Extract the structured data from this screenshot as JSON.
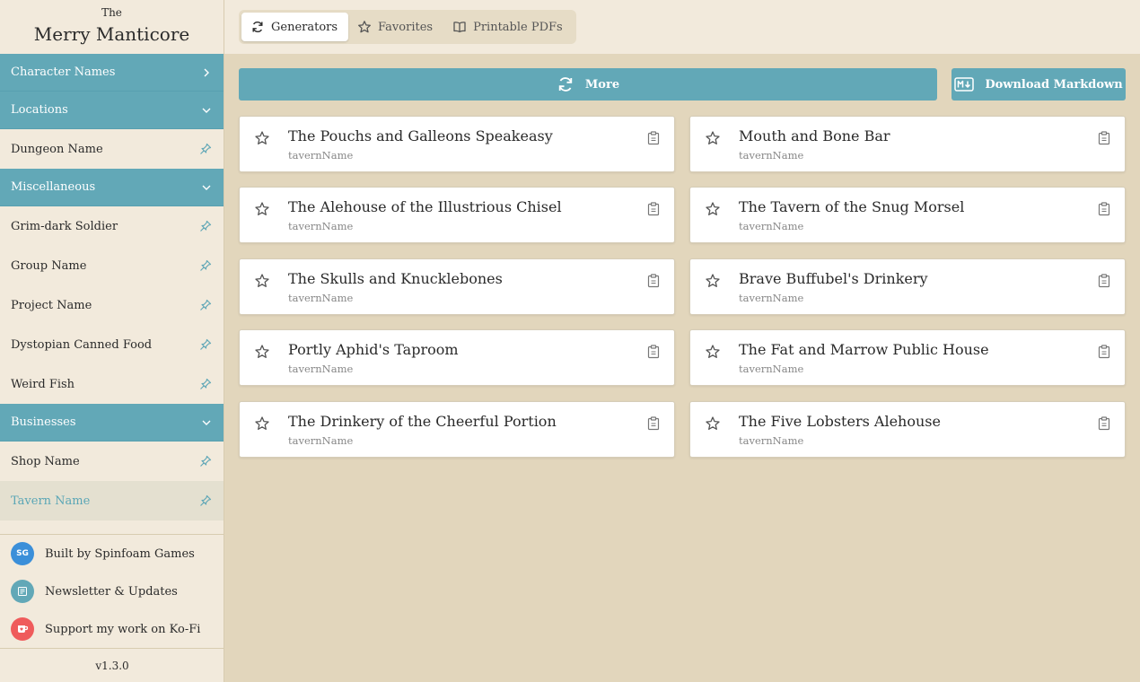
{
  "brand": {
    "the": "The",
    "name": "Merry Manticore"
  },
  "sidebar": {
    "sections": [
      {
        "label": "Character Names",
        "items": []
      },
      {
        "label": "Locations",
        "items": [
          {
            "label": "Dungeon Name"
          }
        ]
      },
      {
        "label": "Miscellaneous",
        "items": [
          {
            "label": "Grim-dark Soldier"
          },
          {
            "label": "Group Name"
          },
          {
            "label": "Project Name"
          },
          {
            "label": "Dystopian Canned Food"
          },
          {
            "label": "Weird Fish"
          }
        ]
      },
      {
        "label": "Businesses",
        "items": [
          {
            "label": "Shop Name"
          },
          {
            "label": "Tavern Name",
            "active": true
          }
        ]
      }
    ],
    "footer": [
      {
        "label": "Built by Spinfoam Games",
        "icon": "spinfoam-logo-icon",
        "badge": "SG",
        "color": "#3b8fd9"
      },
      {
        "label": "Newsletter & Updates",
        "icon": "newsletter-icon",
        "color": "#62a8b7"
      },
      {
        "label": "Support my work on Ko-Fi",
        "icon": "kofi-cup-icon",
        "color": "#ef5b5b"
      }
    ],
    "version": "v1.3.0"
  },
  "tabs": [
    {
      "label": "Generators",
      "icon": "refresh-icon",
      "active": true
    },
    {
      "label": "Favorites",
      "icon": "star-icon"
    },
    {
      "label": "Printable PDFs",
      "icon": "book-icon"
    }
  ],
  "actions": {
    "more_label": "More",
    "download_label": "Download Markdown"
  },
  "results": [
    {
      "name": "The Pouchs and Galleons Speakeasy",
      "type": "tavernName"
    },
    {
      "name": "Mouth and Bone Bar",
      "type": "tavernName"
    },
    {
      "name": "The Alehouse of the Illustrious Chisel",
      "type": "tavernName"
    },
    {
      "name": "The Tavern of the Snug Morsel",
      "type": "tavernName"
    },
    {
      "name": "The Skulls and Knucklebones",
      "type": "tavernName"
    },
    {
      "name": "Brave Buffubel's Drinkery",
      "type": "tavernName"
    },
    {
      "name": "Portly Aphid's Taproom",
      "type": "tavernName"
    },
    {
      "name": "The Fat and Marrow Public House",
      "type": "tavernName"
    },
    {
      "name": "The Drinkery of the Cheerful Portion",
      "type": "tavernName"
    },
    {
      "name": "The Five Lobsters Alehouse",
      "type": "tavernName"
    }
  ],
  "colors": {
    "accent": "#62a8b7",
    "sidebar_bg": "#f2eadc",
    "main_bg": "#e2d6bc"
  }
}
